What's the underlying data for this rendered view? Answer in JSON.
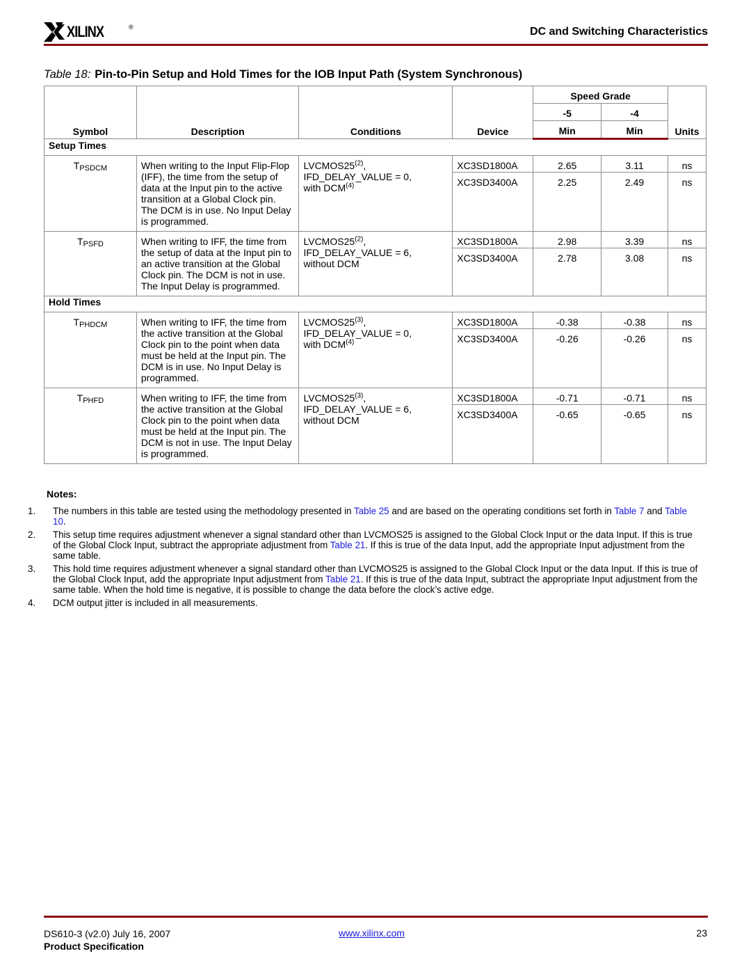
{
  "header": {
    "brand": "XILINX",
    "registered": "®",
    "section_title": "DC and Switching Characteristics"
  },
  "table": {
    "caption_number": "Table 18:",
    "caption_title": "Pin-to-Pin Setup and Hold Times for the IOB Input Path (System Synchronous)",
    "headers": {
      "symbol": "Symbol",
      "description": "Description",
      "conditions": "Conditions",
      "device": "Device",
      "speed_grade": "Speed Grade",
      "grade_5": "-5",
      "grade_4": "-4",
      "min_5": "Min",
      "min_4": "Min",
      "units": "Units"
    },
    "sections": [
      {
        "title": "Setup Times",
        "rows": [
          {
            "symbol_base": "T",
            "symbol_sub": "PSDCM",
            "description": "When writing to the Input Flip-Flop (IFF), the time from the setup of data at the Input pin to the active transition at a Global Clock pin. The DCM is in use. No Input Delay is programmed.",
            "cond_std": "LVCMOS25",
            "cond_std_note": "(2)",
            "cond_delay": "IFD_DELAY_VALUE = 0,",
            "cond_dcm": "with DCM",
            "cond_dcm_note": "(4)",
            "devices": [
              {
                "device": "XC3SD1800A",
                "min_5": "2.65",
                "min_4": "3.11",
                "units": "ns"
              },
              {
                "device": "XC3SD3400A",
                "min_5": "2.25",
                "min_4": "2.49",
                "units": "ns"
              }
            ]
          },
          {
            "symbol_base": "T",
            "symbol_sub": "PSFD",
            "description": "When writing to IFF, the time from the setup of data at the Input pin to an active transition at the Global Clock pin. The DCM is not in use. The Input Delay is programmed.",
            "cond_std": "LVCMOS25",
            "cond_std_note": "(2)",
            "cond_delay": "IFD_DELAY_VALUE = 6,",
            "cond_dcm": "without DCM",
            "cond_dcm_note": "",
            "devices": [
              {
                "device": "XC3SD1800A",
                "min_5": "2.98",
                "min_4": "3.39",
                "units": "ns"
              },
              {
                "device": "XC3SD3400A",
                "min_5": "2.78",
                "min_4": "3.08",
                "units": "ns"
              }
            ]
          }
        ]
      },
      {
        "title": "Hold Times",
        "rows": [
          {
            "symbol_base": "T",
            "symbol_sub": "PHDCM",
            "description": "When writing to IFF, the time from the active transition at the Global Clock pin to the point when data must be held at the Input pin. The DCM is in use. No Input Delay is programmed.",
            "cond_std": "LVCMOS25",
            "cond_std_note": "(3)",
            "cond_delay": "IFD_DELAY_VALUE = 0,",
            "cond_dcm": "with DCM",
            "cond_dcm_note": "(4)",
            "devices": [
              {
                "device": "XC3SD1800A",
                "min_5": "-0.38",
                "min_4": "-0.38",
                "units": "ns"
              },
              {
                "device": "XC3SD3400A",
                "min_5": "-0.26",
                "min_4": "-0.26",
                "units": "ns"
              }
            ]
          },
          {
            "symbol_base": "T",
            "symbol_sub": "PHFD",
            "description": "When writing to IFF, the time from the active transition at the Global Clock pin to the point when data must be held at the Input pin. The DCM is not in use. The Input Delay is programmed.",
            "cond_std": "LVCMOS25",
            "cond_std_note": "(3)",
            "cond_delay": "IFD_DELAY_VALUE = 6,",
            "cond_dcm": "without DCM",
            "cond_dcm_note": "",
            "devices": [
              {
                "device": "XC3SD1800A",
                "min_5": "-0.71",
                "min_4": "-0.71",
                "units": "ns"
              },
              {
                "device": "XC3SD3400A",
                "min_5": "-0.65",
                "min_4": "-0.65",
                "units": "ns"
              }
            ]
          }
        ]
      }
    ]
  },
  "notes": {
    "title": "Notes:",
    "items": [
      {
        "num": "1.",
        "parts": [
          {
            "t": "The numbers in this table are tested using the methodology presented in "
          },
          {
            "t": "Table 25",
            "link": true
          },
          {
            "t": " and are based on the operating conditions set forth in "
          },
          {
            "t": "Table 7",
            "link": true
          },
          {
            "t": " and "
          },
          {
            "t": "Table 10",
            "link": true
          },
          {
            "t": "."
          }
        ]
      },
      {
        "num": "2.",
        "parts": [
          {
            "t": "This setup time requires adjustment whenever a signal standard other than LVCMOS25 is assigned to the Global Clock Input or the data Input. If this is true of the Global Clock Input, subtract the appropriate adjustment from "
          },
          {
            "t": "Table 21",
            "link": true
          },
          {
            "t": ". If this is true of the data Input, add the appropriate Input adjustment from the same table."
          }
        ]
      },
      {
        "num": "3.",
        "parts": [
          {
            "t": "This hold time requires adjustment whenever a signal standard other than LVCMOS25 is assigned to the Global Clock Input or the data Input. If this is true of the Global Clock Input, add the appropriate Input adjustment from "
          },
          {
            "t": "Table 21",
            "link": true
          },
          {
            "t": ". If this is true of the data Input, subtract the appropriate Input adjustment from the same table. When the hold time is negative, it is possible to change the data before the clock’s active edge."
          }
        ]
      },
      {
        "num": "4.",
        "parts": [
          {
            "t": "DCM output jitter is included in all measurements."
          }
        ]
      }
    ]
  },
  "footer": {
    "doc_id": "DS610-3 (v2.0) July 16, 2007",
    "doc_type": "Product Specification",
    "website": "www.xilinx.com",
    "page_number": "23"
  },
  "colors": {
    "rule": "#8b0d14",
    "link": "#1a1adb",
    "grid": "#8c8c8c"
  }
}
